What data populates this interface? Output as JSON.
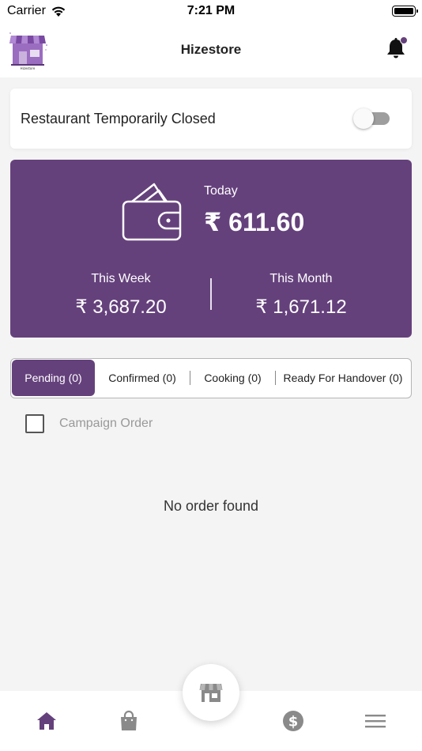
{
  "status_bar": {
    "carrier": "Carrier",
    "time": "7:21 PM"
  },
  "header": {
    "title": "Hizestore",
    "logo_caption": "Hizestore",
    "notification_dot_color": "#65417c"
  },
  "store_status": {
    "label": "Restaurant Temporarily Closed",
    "toggle_on": false
  },
  "earnings": {
    "today_label": "Today",
    "today_value": "₹ 611.60",
    "week_label": "This Week",
    "week_value": "₹ 3,687.20",
    "month_label": "This Month",
    "month_value": "₹ 1,671.12"
  },
  "tabs": [
    {
      "label": "Pending (0)",
      "active": true
    },
    {
      "label": "Confirmed (0)",
      "active": false
    },
    {
      "label": "Cooking (0)",
      "active": false
    },
    {
      "label": "Ready For Handover (0)",
      "active": false
    }
  ],
  "campaign": {
    "label": "Campaign Order",
    "checked": false
  },
  "empty_message": "No order found",
  "bottom_nav": {
    "items": [
      {
        "icon": "home-icon",
        "active": true
      },
      {
        "icon": "shopping-bag-icon",
        "active": false
      },
      {
        "icon": "store-icon",
        "active": false
      },
      {
        "icon": "dollar-icon",
        "active": false
      },
      {
        "icon": "menu-icon",
        "active": false
      }
    ]
  },
  "colors": {
    "primary": "#65417c",
    "inactive_icon": "#8a8a8a",
    "background": "#f4f4f4"
  }
}
